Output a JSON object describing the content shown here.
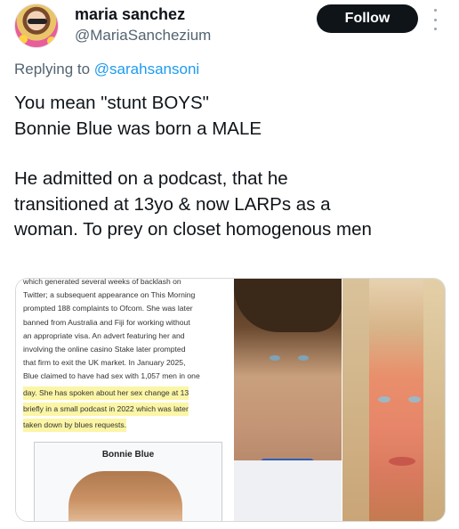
{
  "author": {
    "name": "maria sanchez",
    "handle": "@MariaSanchezium"
  },
  "follow_label": "Follow",
  "reply": {
    "prefix": "Replying to",
    "mention": "@sarahsansoni"
  },
  "tweet": {
    "lines": [
      "You mean \"stunt BOYS\"",
      "Bonnie Blue was born a MALE",
      "",
      "He admitted on a podcast, that he",
      "transitioned at 13yo & now LARPs as a",
      "woman. To prey on closet homogenous men"
    ]
  },
  "media": {
    "doc_lines": [
      "which generated several weeks of backlash on",
      "Twitter; a subsequent appearance on This Morning",
      "prompted 188 complaints to Ofcom. She was later",
      "banned from Australia and Fiji for working without",
      "an appropriate visa. An advert featuring her and",
      "involving the online casino Stake later prompted",
      "that firm to exit the UK market. In January 2025,",
      "Blue claimed to have had sex with 1,057 men in one",
      "day. She has spoken about her sex change at 13",
      "briefly in a small podcast in 2022 which was later",
      "taken down by blues requests."
    ],
    "infobox_title": "Bonnie Blue"
  }
}
